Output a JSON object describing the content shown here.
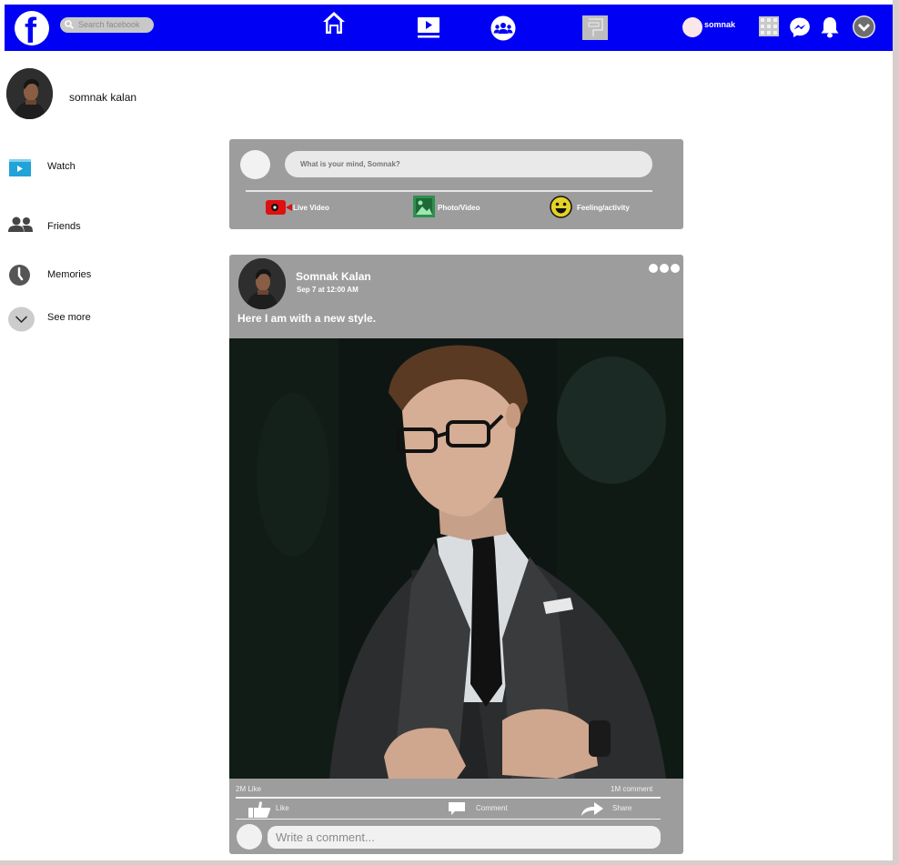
{
  "topbar": {
    "logo_letter": "f",
    "search": {
      "placeholder": "Search facebook"
    },
    "nav": [
      {
        "icon": "home-icon"
      },
      {
        "icon": "watch-icon"
      },
      {
        "icon": "groups-icon"
      },
      {
        "icon": "pages-icon"
      }
    ],
    "user": {
      "name": "somnak"
    },
    "right_icons": [
      "apps-grid-icon",
      "messenger-icon",
      "bell-icon",
      "chevron-down-icon"
    ],
    "color": "#0000f5"
  },
  "sidebar": {
    "profile": {
      "name": "somnak kalan"
    },
    "items": [
      {
        "label": "Watch",
        "icon": "watch-icon",
        "color": "#1fa3d9"
      },
      {
        "label": "Friends",
        "icon": "friends-icon"
      },
      {
        "label": "Memories",
        "icon": "clock-icon"
      },
      {
        "label": "See more",
        "icon": "chevron-down-icon"
      }
    ]
  },
  "composer": {
    "placeholder": "What is your mind, Somnak?",
    "actions": [
      {
        "label": "Live Video",
        "icon": "live-video-icon",
        "color": "#e01010"
      },
      {
        "label": "Photo/Video",
        "icon": "photo-icon",
        "color": "#2f8f4f"
      },
      {
        "label": "Feeling/activity",
        "icon": "smiley-icon",
        "color": "#e3d325"
      }
    ]
  },
  "post": {
    "author": "Somnak Kalan",
    "time": "Sep 7 at 12:00 AM",
    "caption": "Here I am with a new style.",
    "stats": {
      "likes": "2M Like",
      "comments": "1M comment"
    },
    "actions": [
      {
        "label": "Like",
        "icon": "thumbs-up-icon"
      },
      {
        "label": "Comment",
        "icon": "comment-icon"
      },
      {
        "label": "Share",
        "icon": "share-icon"
      }
    ],
    "comment_placeholder": "Write a comment..."
  }
}
